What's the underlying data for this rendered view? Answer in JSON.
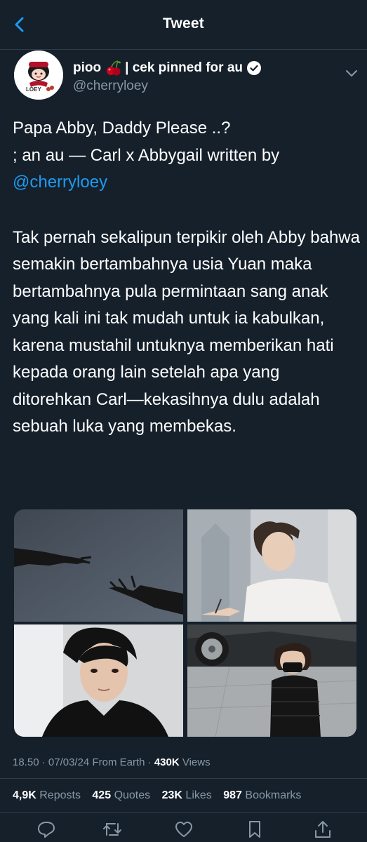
{
  "header": {
    "title": "Tweet",
    "back_icon": "chevron-left-icon"
  },
  "author": {
    "name": "pioo",
    "name_suffix": "| cek pinned for au",
    "handle": "@cherryloey",
    "avatar_text": "LOEY",
    "cherry_icon": "cherry-emoji",
    "verified_icon": "verified-badge-icon"
  },
  "tweet": {
    "line1": "Papa Abby, Daddy Please ..?",
    "line2": "; an au — Carl x Abbygail written by",
    "mention": "@cherryloey",
    "paragraph": "Tak pernah sekalipun terpikir oleh Abby bahwa semakin bertambahnya usia Yuan maka bertambahnya pula permintaan sang anak yang kali ini tak mudah untuk ia kabulkan, karena mustahil untuknya memberikan hati kepada orang lain setelah apa yang ditorehkan Carl—kekasihnya dulu adalah sebuah luka yang membekas."
  },
  "meta": {
    "time": "18.50",
    "date": "07/03/24",
    "source": "From Earth",
    "views_count": "430K",
    "views_label": "Views"
  },
  "stats": {
    "reposts_count": "4,9K",
    "reposts_label": "Reposts",
    "quotes_count": "425",
    "quotes_label": "Quotes",
    "likes_count": "23K",
    "likes_label": "Likes",
    "bookmarks_count": "987",
    "bookmarks_label": "Bookmarks"
  },
  "actions": [
    "reply-icon",
    "retweet-icon",
    "like-icon",
    "bookmark-icon",
    "share-icon"
  ],
  "colors": {
    "background": "#15202b",
    "accent": "#1d9bf0",
    "secondary_text": "#8899a6",
    "divider": "#2f3b47"
  }
}
